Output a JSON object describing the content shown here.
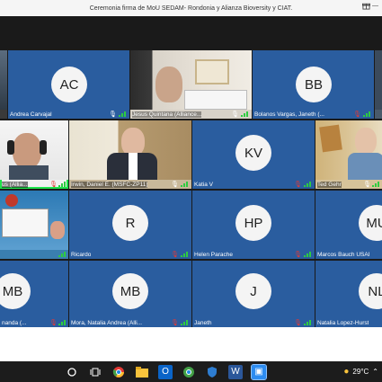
{
  "window": {
    "title": "Ceremonia firma de MoU SEDAM- Rondonia y Alianza Bioversity y CIAT."
  },
  "participants": [
    {
      "name": "",
      "initials": "",
      "type": "video"
    },
    {
      "name": "Andrea Carvajal",
      "initials": "AC",
      "type": "avatar"
    },
    {
      "name": "Jesus Quintana (Alliance...",
      "initials": "",
      "type": "video"
    },
    {
      "name": "Bolanos Vargas, Janeth (...",
      "initials": "BB",
      "type": "avatar"
    },
    {
      "name": "",
      "initials": "",
      "type": "video"
    },
    {
      "name": "us (Allia...",
      "initials": "",
      "type": "video"
    },
    {
      "name": "Irwin, Daniel E. (MSFC-ZP11)",
      "initials": "",
      "type": "video"
    },
    {
      "name": "Katia V",
      "initials": "KV",
      "type": "avatar"
    },
    {
      "name": "Ted Gehr",
      "initials": "",
      "type": "video"
    },
    {
      "name": "",
      "initials": "",
      "type": "video"
    },
    {
      "name": "Ricardo",
      "initials": "R",
      "type": "avatar"
    },
    {
      "name": "Helen Parache",
      "initials": "HP",
      "type": "avatar"
    },
    {
      "name": "Marcos Bauch USAID/B...",
      "initials": "MU",
      "type": "avatar"
    },
    {
      "name": "nanda (...",
      "initials": "MB",
      "type": "avatar"
    },
    {
      "name": "Mora, Natalia Andrea (Alli...",
      "initials": "MB",
      "type": "avatar"
    },
    {
      "name": "Janeth",
      "initials": "J",
      "type": "avatar"
    },
    {
      "name": "Natalia Lopez-Hurst",
      "initials": "NL",
      "type": "avatar"
    }
  ],
  "taskbar": {
    "temperature": "29°C"
  },
  "colors": {
    "tile_bg": "#2a5d9f",
    "active_border": "#1ee34a"
  }
}
